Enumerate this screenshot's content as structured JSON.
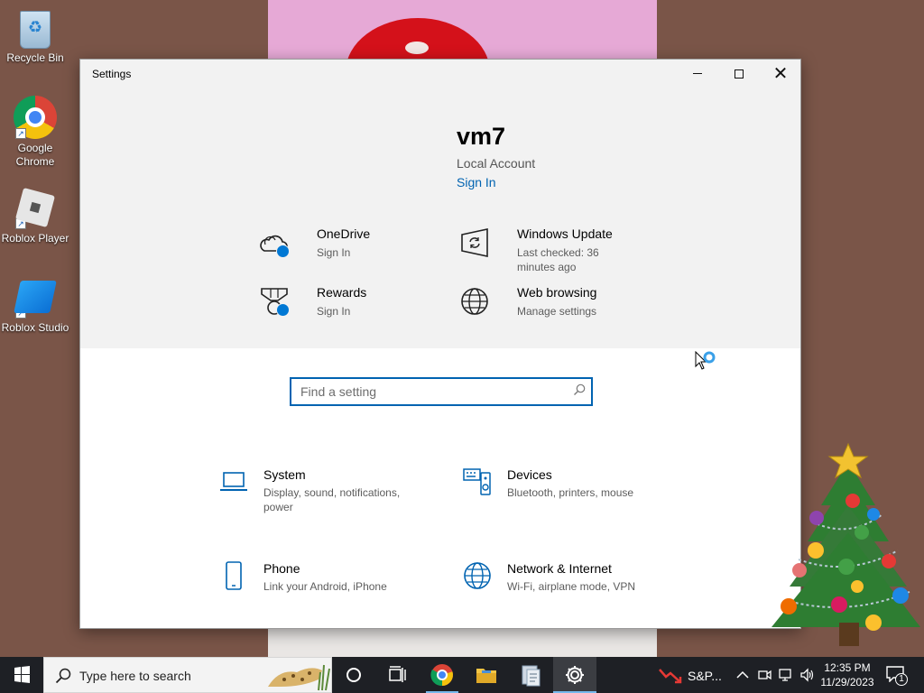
{
  "desktop": {
    "icons": [
      {
        "label": "Recycle Bin",
        "icon": "recycle-bin-icon"
      },
      {
        "label": "Google Chrome",
        "icon": "chrome-icon"
      },
      {
        "label": "Roblox Player",
        "icon": "roblox-player-icon"
      },
      {
        "label": "Roblox Studio",
        "icon": "roblox-studio-icon"
      }
    ]
  },
  "window": {
    "title": "Settings",
    "controls": {
      "minimize": "minimize-icon",
      "maximize": "maximize-icon",
      "close": "close-icon"
    }
  },
  "account": {
    "name": "vm7",
    "type": "Local Account",
    "sign_in": "Sign In"
  },
  "quick_tiles": [
    {
      "title": "OneDrive",
      "subtitle": "Sign In",
      "icon": "onedrive-icon"
    },
    {
      "title": "Windows Update",
      "subtitle": "Last checked: 36 minutes ago",
      "icon": "windows-update-icon"
    },
    {
      "title": "Rewards",
      "subtitle": "Sign In",
      "icon": "rewards-icon"
    },
    {
      "title": "Web browsing",
      "subtitle": "Manage settings",
      "icon": "globe-icon"
    }
  ],
  "search": {
    "placeholder": "Find a setting",
    "icon": "search-icon"
  },
  "categories": [
    {
      "title": "System",
      "subtitle": "Display, sound, notifications, power",
      "icon": "laptop-icon"
    },
    {
      "title": "Devices",
      "subtitle": "Bluetooth, printers, mouse",
      "icon": "keyboard-speaker-icon"
    },
    {
      "title": "Phone",
      "subtitle": "Link your Android, iPhone",
      "icon": "phone-icon"
    },
    {
      "title": "Network & Internet",
      "subtitle": "Wi-Fi, airplane mode, VPN",
      "icon": "globe-icon"
    }
  ],
  "taskbar": {
    "search_placeholder": "Type here to search",
    "apps": [
      "cortana-icon",
      "task-view-icon",
      "chrome-icon",
      "file-explorer-icon",
      "app-icon",
      "settings-gear-icon"
    ],
    "stock_widget": "S&P...",
    "clock": {
      "time": "12:35 PM",
      "date": "11/29/2023"
    },
    "notification_count": "1"
  },
  "colors": {
    "accent": "#0063b1",
    "window_top": "#f2f2f2",
    "taskbar": "#1e2025",
    "desktop": "#7a5548"
  }
}
